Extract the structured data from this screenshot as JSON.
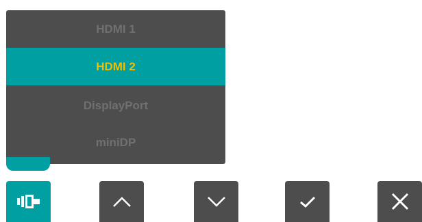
{
  "menu": {
    "items": [
      {
        "label": "HDMI 1",
        "selected": false
      },
      {
        "label": "HDMI 2",
        "selected": true
      },
      {
        "label": "DisplayPort",
        "selected": false
      },
      {
        "label": "miniDP",
        "selected": false
      }
    ]
  },
  "controls": [
    {
      "icon": "input-source-icon"
    },
    {
      "icon": "chevron-up-icon"
    },
    {
      "icon": "chevron-down-icon"
    },
    {
      "icon": "checkmark-icon"
    },
    {
      "icon": "close-icon"
    }
  ],
  "colors": {
    "accent": "#00a0a2",
    "panel": "#4d4d4d",
    "selected_text": "#f0c000",
    "unselected_text": "#707070",
    "icon": "#ffffff"
  }
}
